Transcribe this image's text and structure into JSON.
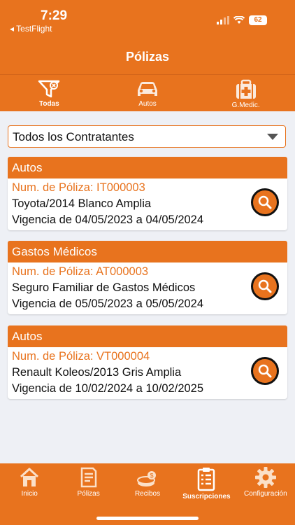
{
  "status": {
    "time": "7:29",
    "back_app": "◂ TestFlight",
    "battery": "62"
  },
  "nav": {
    "title": "Pólizas"
  },
  "tabs": [
    {
      "label": "Todas",
      "icon": "filter-icon"
    },
    {
      "label": "Autos",
      "icon": "car-icon"
    },
    {
      "label": "G.Medic.",
      "icon": "medical-kit-icon"
    }
  ],
  "selector": {
    "value": "Todos los Contratantes"
  },
  "policies": [
    {
      "section": "Autos",
      "number": "Num. de Póliza: IT000003",
      "description": "Toyota/2014 Blanco Amplia",
      "validity": "Vigencia de 04/05/2023 a 04/05/2024"
    },
    {
      "section": "Gastos Médicos",
      "number": "Num. de Póliza: AT000003",
      "description": "Seguro Familiar de Gastos Médicos",
      "validity": "Vigencia de 05/05/2023 a 05/05/2024"
    },
    {
      "section": "Autos",
      "number": "Num. de Póliza: VT000004",
      "description": "Renault Koleos/2013 Gris Amplia",
      "validity": "Vigencia de 10/02/2024 a 10/02/2025"
    }
  ],
  "bottom_nav": [
    {
      "label": "Inicio",
      "icon": "home-icon"
    },
    {
      "label": "Pólizas",
      "icon": "document-icon"
    },
    {
      "label": "Recibos",
      "icon": "coins-icon"
    },
    {
      "label": "Suscripciones",
      "icon": "clipboard-icon"
    },
    {
      "label": "Configuración",
      "icon": "gear-icon"
    }
  ],
  "colors": {
    "accent": "#e8731e",
    "background": "#eef0f5"
  }
}
